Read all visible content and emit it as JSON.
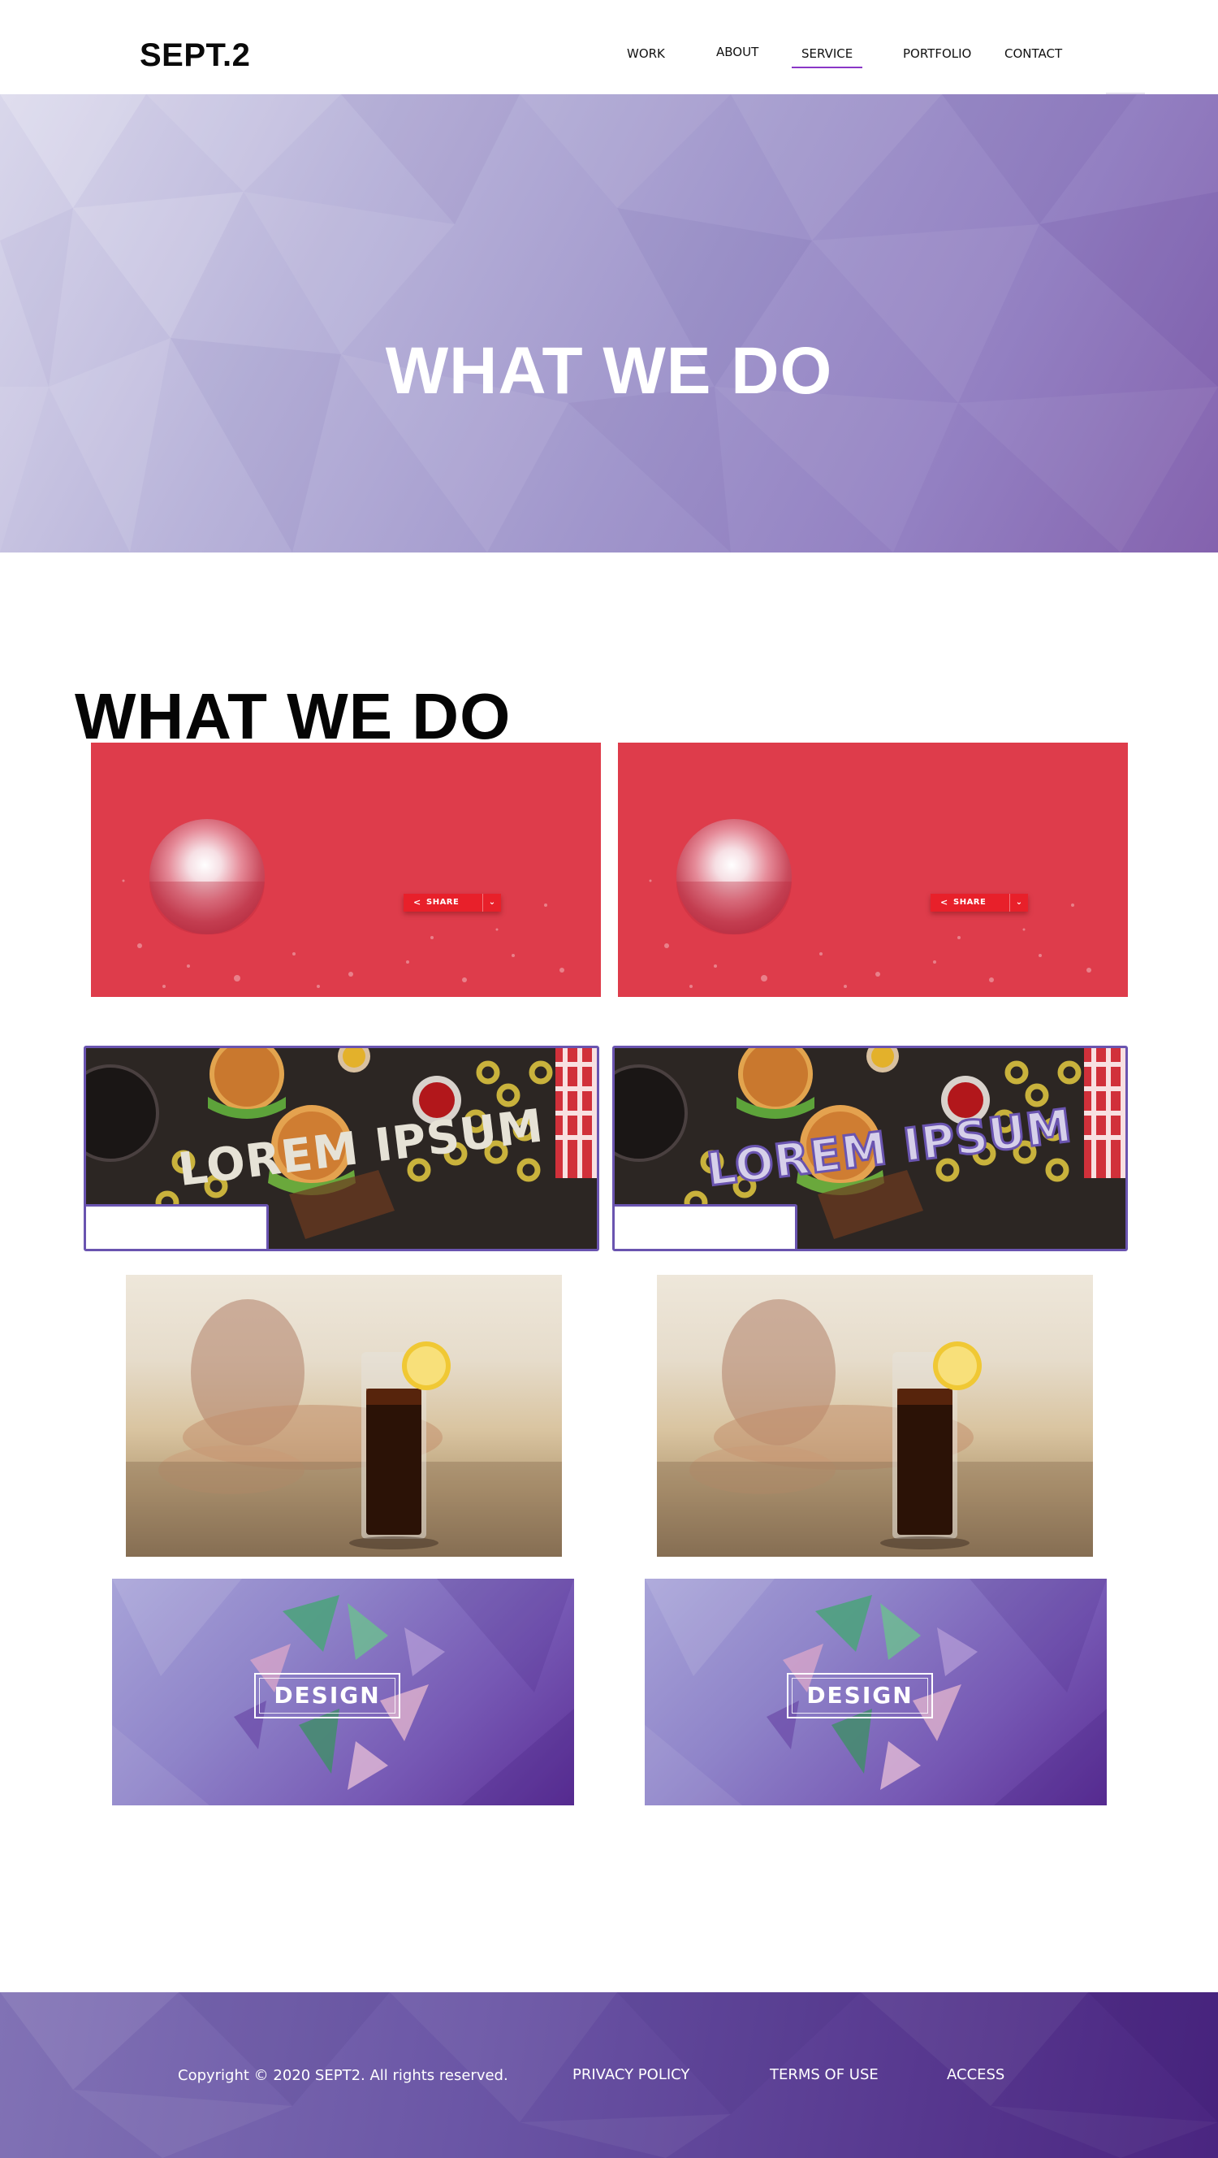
{
  "header": {
    "logo": "SEPT.2",
    "nav": [
      "WORK",
      "ABOUT",
      "SERVICE",
      "PORTFOLIO",
      "CONTACT"
    ],
    "active_nav": "SERVICE",
    "accent_color": "#8a37c7"
  },
  "hero": {
    "title": "WHAT WE DO"
  },
  "main": {
    "title": "WHAT WE DO",
    "share_cards": {
      "button_label": "SHARE",
      "icon": "share-icon",
      "background": "#de3c4b"
    },
    "food_cards": {
      "overlay_text": "LOREM IPSUM",
      "border_color": "#6a54b0"
    },
    "design_cards": {
      "label": "DESIGN"
    }
  },
  "footer": {
    "copyright": "Copyright © 2020 SEPT2. All rights reserved.",
    "links": [
      "PRIVACY POLICY",
      "TERMS OF USE",
      "ACCESS"
    ]
  }
}
